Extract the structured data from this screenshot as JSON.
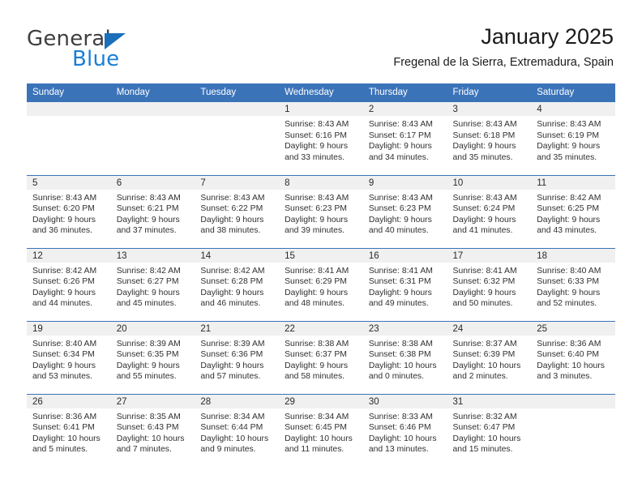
{
  "brand": {
    "name_part1": "General",
    "name_part2": "Blue",
    "accent_color": "#1b7fd4",
    "triangle_color": "#1b6fba"
  },
  "header": {
    "title": "January 2025",
    "subtitle": "Fregenal de la Sierra, Extremadura, Spain",
    "header_bg": "#3b73b9",
    "daynum_bg": "#f0f0f0"
  },
  "weekdays": [
    "Sunday",
    "Monday",
    "Tuesday",
    "Wednesday",
    "Thursday",
    "Friday",
    "Saturday"
  ],
  "weeks": [
    [
      {
        "day": "",
        "sunrise": "",
        "sunset": "",
        "daylight1": "",
        "daylight2": ""
      },
      {
        "day": "",
        "sunrise": "",
        "sunset": "",
        "daylight1": "",
        "daylight2": ""
      },
      {
        "day": "",
        "sunrise": "",
        "sunset": "",
        "daylight1": "",
        "daylight2": ""
      },
      {
        "day": "1",
        "sunrise": "Sunrise: 8:43 AM",
        "sunset": "Sunset: 6:16 PM",
        "daylight1": "Daylight: 9 hours",
        "daylight2": "and 33 minutes."
      },
      {
        "day": "2",
        "sunrise": "Sunrise: 8:43 AM",
        "sunset": "Sunset: 6:17 PM",
        "daylight1": "Daylight: 9 hours",
        "daylight2": "and 34 minutes."
      },
      {
        "day": "3",
        "sunrise": "Sunrise: 8:43 AM",
        "sunset": "Sunset: 6:18 PM",
        "daylight1": "Daylight: 9 hours",
        "daylight2": "and 35 minutes."
      },
      {
        "day": "4",
        "sunrise": "Sunrise: 8:43 AM",
        "sunset": "Sunset: 6:19 PM",
        "daylight1": "Daylight: 9 hours",
        "daylight2": "and 35 minutes."
      }
    ],
    [
      {
        "day": "5",
        "sunrise": "Sunrise: 8:43 AM",
        "sunset": "Sunset: 6:20 PM",
        "daylight1": "Daylight: 9 hours",
        "daylight2": "and 36 minutes."
      },
      {
        "day": "6",
        "sunrise": "Sunrise: 8:43 AM",
        "sunset": "Sunset: 6:21 PM",
        "daylight1": "Daylight: 9 hours",
        "daylight2": "and 37 minutes."
      },
      {
        "day": "7",
        "sunrise": "Sunrise: 8:43 AM",
        "sunset": "Sunset: 6:22 PM",
        "daylight1": "Daylight: 9 hours",
        "daylight2": "and 38 minutes."
      },
      {
        "day": "8",
        "sunrise": "Sunrise: 8:43 AM",
        "sunset": "Sunset: 6:23 PM",
        "daylight1": "Daylight: 9 hours",
        "daylight2": "and 39 minutes."
      },
      {
        "day": "9",
        "sunrise": "Sunrise: 8:43 AM",
        "sunset": "Sunset: 6:23 PM",
        "daylight1": "Daylight: 9 hours",
        "daylight2": "and 40 minutes."
      },
      {
        "day": "10",
        "sunrise": "Sunrise: 8:43 AM",
        "sunset": "Sunset: 6:24 PM",
        "daylight1": "Daylight: 9 hours",
        "daylight2": "and 41 minutes."
      },
      {
        "day": "11",
        "sunrise": "Sunrise: 8:42 AM",
        "sunset": "Sunset: 6:25 PM",
        "daylight1": "Daylight: 9 hours",
        "daylight2": "and 43 minutes."
      }
    ],
    [
      {
        "day": "12",
        "sunrise": "Sunrise: 8:42 AM",
        "sunset": "Sunset: 6:26 PM",
        "daylight1": "Daylight: 9 hours",
        "daylight2": "and 44 minutes."
      },
      {
        "day": "13",
        "sunrise": "Sunrise: 8:42 AM",
        "sunset": "Sunset: 6:27 PM",
        "daylight1": "Daylight: 9 hours",
        "daylight2": "and 45 minutes."
      },
      {
        "day": "14",
        "sunrise": "Sunrise: 8:42 AM",
        "sunset": "Sunset: 6:28 PM",
        "daylight1": "Daylight: 9 hours",
        "daylight2": "and 46 minutes."
      },
      {
        "day": "15",
        "sunrise": "Sunrise: 8:41 AM",
        "sunset": "Sunset: 6:29 PM",
        "daylight1": "Daylight: 9 hours",
        "daylight2": "and 48 minutes."
      },
      {
        "day": "16",
        "sunrise": "Sunrise: 8:41 AM",
        "sunset": "Sunset: 6:31 PM",
        "daylight1": "Daylight: 9 hours",
        "daylight2": "and 49 minutes."
      },
      {
        "day": "17",
        "sunrise": "Sunrise: 8:41 AM",
        "sunset": "Sunset: 6:32 PM",
        "daylight1": "Daylight: 9 hours",
        "daylight2": "and 50 minutes."
      },
      {
        "day": "18",
        "sunrise": "Sunrise: 8:40 AM",
        "sunset": "Sunset: 6:33 PM",
        "daylight1": "Daylight: 9 hours",
        "daylight2": "and 52 minutes."
      }
    ],
    [
      {
        "day": "19",
        "sunrise": "Sunrise: 8:40 AM",
        "sunset": "Sunset: 6:34 PM",
        "daylight1": "Daylight: 9 hours",
        "daylight2": "and 53 minutes."
      },
      {
        "day": "20",
        "sunrise": "Sunrise: 8:39 AM",
        "sunset": "Sunset: 6:35 PM",
        "daylight1": "Daylight: 9 hours",
        "daylight2": "and 55 minutes."
      },
      {
        "day": "21",
        "sunrise": "Sunrise: 8:39 AM",
        "sunset": "Sunset: 6:36 PM",
        "daylight1": "Daylight: 9 hours",
        "daylight2": "and 57 minutes."
      },
      {
        "day": "22",
        "sunrise": "Sunrise: 8:38 AM",
        "sunset": "Sunset: 6:37 PM",
        "daylight1": "Daylight: 9 hours",
        "daylight2": "and 58 minutes."
      },
      {
        "day": "23",
        "sunrise": "Sunrise: 8:38 AM",
        "sunset": "Sunset: 6:38 PM",
        "daylight1": "Daylight: 10 hours",
        "daylight2": "and 0 minutes."
      },
      {
        "day": "24",
        "sunrise": "Sunrise: 8:37 AM",
        "sunset": "Sunset: 6:39 PM",
        "daylight1": "Daylight: 10 hours",
        "daylight2": "and 2 minutes."
      },
      {
        "day": "25",
        "sunrise": "Sunrise: 8:36 AM",
        "sunset": "Sunset: 6:40 PM",
        "daylight1": "Daylight: 10 hours",
        "daylight2": "and 3 minutes."
      }
    ],
    [
      {
        "day": "26",
        "sunrise": "Sunrise: 8:36 AM",
        "sunset": "Sunset: 6:41 PM",
        "daylight1": "Daylight: 10 hours",
        "daylight2": "and 5 minutes."
      },
      {
        "day": "27",
        "sunrise": "Sunrise: 8:35 AM",
        "sunset": "Sunset: 6:43 PM",
        "daylight1": "Daylight: 10 hours",
        "daylight2": "and 7 minutes."
      },
      {
        "day": "28",
        "sunrise": "Sunrise: 8:34 AM",
        "sunset": "Sunset: 6:44 PM",
        "daylight1": "Daylight: 10 hours",
        "daylight2": "and 9 minutes."
      },
      {
        "day": "29",
        "sunrise": "Sunrise: 8:34 AM",
        "sunset": "Sunset: 6:45 PM",
        "daylight1": "Daylight: 10 hours",
        "daylight2": "and 11 minutes."
      },
      {
        "day": "30",
        "sunrise": "Sunrise: 8:33 AM",
        "sunset": "Sunset: 6:46 PM",
        "daylight1": "Daylight: 10 hours",
        "daylight2": "and 13 minutes."
      },
      {
        "day": "31",
        "sunrise": "Sunrise: 8:32 AM",
        "sunset": "Sunset: 6:47 PM",
        "daylight1": "Daylight: 10 hours",
        "daylight2": "and 15 minutes."
      },
      {
        "day": "",
        "sunrise": "",
        "sunset": "",
        "daylight1": "",
        "daylight2": ""
      }
    ]
  ]
}
